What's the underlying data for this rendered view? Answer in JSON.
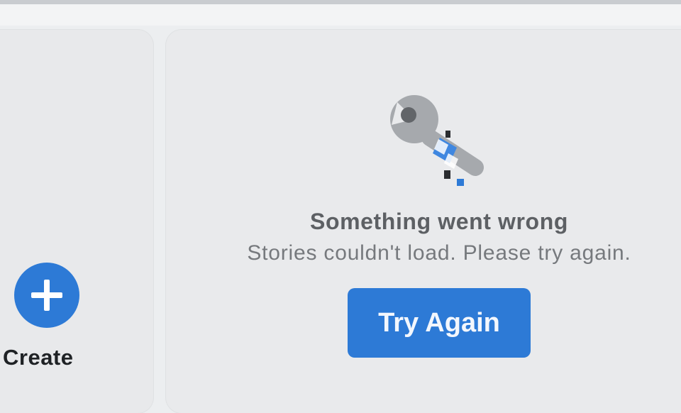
{
  "stories": {
    "create_card": {
      "label": "Create",
      "icon": "plus-icon"
    },
    "error": {
      "icon": "wrench-icon",
      "title": "Something went wrong",
      "message": "Stories couldn't load. Please try again.",
      "retry_label": "Try Again"
    }
  },
  "colors": {
    "accent": "#2d7ad6",
    "card_background": "#e9eaec",
    "title_text": "#5d6064",
    "message_text": "#76797d"
  }
}
